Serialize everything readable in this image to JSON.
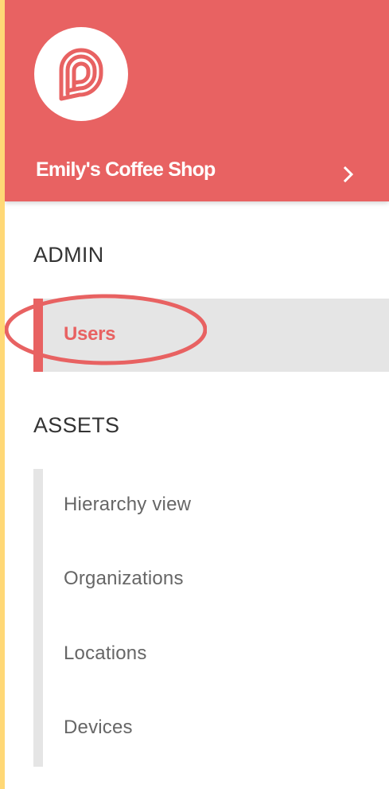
{
  "header": {
    "org_name": "Emily's Coffee Shop"
  },
  "sections": {
    "admin_label": "ADMIN",
    "assets_label": "ASSETS"
  },
  "admin": {
    "items": [
      {
        "label": "Users",
        "active": true
      }
    ]
  },
  "assets": {
    "items": [
      {
        "label": "Hierarchy view"
      },
      {
        "label": "Organizations"
      },
      {
        "label": "Locations"
      },
      {
        "label": "Devices"
      }
    ]
  },
  "colors": {
    "accent": "#e86262",
    "page_border": "#ffd876",
    "active_bg": "#e5e5e5"
  },
  "icons": {
    "logo": "brand-logo-icon",
    "org_switch": "chevron-right-icon"
  }
}
